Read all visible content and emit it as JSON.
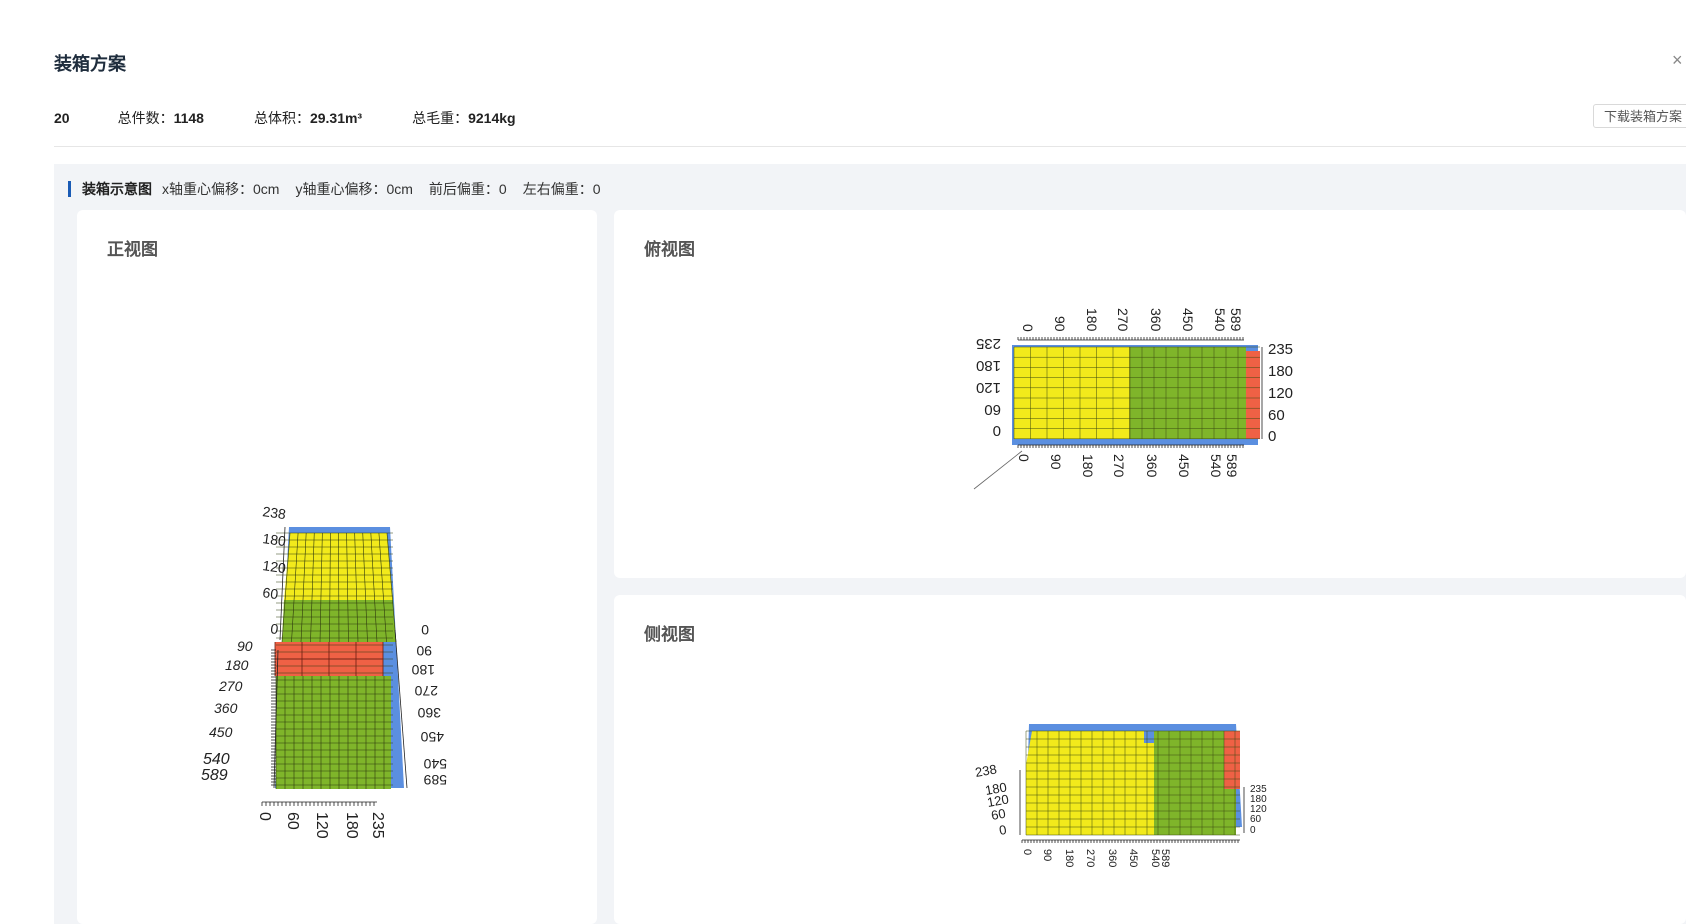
{
  "header": {
    "title": "装箱方案",
    "close_icon": "×"
  },
  "summary": {
    "count_value": "20",
    "total_pieces_label": "总件数：",
    "total_pieces_value": "1148",
    "total_volume_label": "总体积：",
    "total_volume_value": "29.31m³",
    "total_weight_label": "总毛重：",
    "total_weight_value": "9214kg",
    "download_label": "下载装箱方案"
  },
  "section": {
    "title": "装箱示意图",
    "x_offset_label": "x轴重心偏移：",
    "x_offset_value": "0cm",
    "y_offset_label": "y轴重心偏移：",
    "y_offset_value": "0cm",
    "front_back_label": "前后偏重：",
    "front_back_value": "0",
    "left_right_label": "左右偏重：",
    "left_right_value": "0"
  },
  "views": {
    "front": {
      "title": "正视图",
      "height_ticks": [
        "238",
        "180",
        "120",
        "60",
        "0"
      ],
      "length_ticks": [
        "90",
        "180",
        "270",
        "360",
        "450",
        "540",
        "589"
      ],
      "mirrored_length_ticks": [
        "0",
        "90",
        "180",
        "270",
        "360",
        "450",
        "540",
        "589"
      ],
      "width_ticks": [
        "0",
        "60",
        "120",
        "180",
        "235"
      ]
    },
    "top": {
      "title": "俯视图",
      "length_ticks": [
        "0",
        "90",
        "180",
        "270",
        "360",
        "450",
        "540",
        "589"
      ],
      "width_ticks": [
        "235",
        "180",
        "120",
        "60",
        "0"
      ]
    },
    "side": {
      "title": "侧视图",
      "height_ticks": [
        "238",
        "180",
        "120",
        "60",
        "0"
      ],
      "length_ticks": [
        "0",
        "90",
        "180",
        "270",
        "360",
        "450",
        "540",
        "589"
      ],
      "width_ticks": [
        "235",
        "180",
        "120",
        "60",
        "0"
      ]
    }
  },
  "colors": {
    "yellow": "#f2ea1b",
    "green": "#7fb52a",
    "red": "#ef6145",
    "container": "#5b8fe0",
    "accent": "#1a5bb5"
  }
}
